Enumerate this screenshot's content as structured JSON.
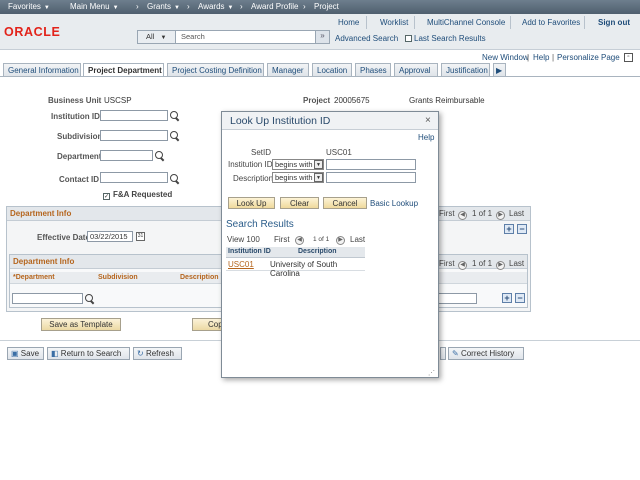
{
  "topnav": {
    "favorites": "Favorites",
    "main_menu": "Main Menu",
    "breadcrumb": [
      "Grants",
      "Awards",
      "Award Profile",
      "Project"
    ]
  },
  "header": {
    "links": [
      "Home",
      "Worklist",
      "MultiChannel Console",
      "Add to Favorites",
      "Sign out"
    ],
    "logo": "ORACLE",
    "search": {
      "scope": "All",
      "placeholder": "Search",
      "go": "»"
    },
    "advanced_search": "Advanced Search",
    "last_search_results": "Last Search Results"
  },
  "page_links": [
    "New Window",
    "Help",
    "Personalize Page"
  ],
  "tabs": [
    "General Information",
    "Project Department",
    "Project Costing Definition",
    "Manager",
    "Location",
    "Phases",
    "Approval",
    "Justification"
  ],
  "active_tab": "Project Department",
  "form": {
    "business_unit_label": "Business Unit",
    "business_unit_value": "USCSP",
    "project_label": "Project",
    "project_value": "20005675",
    "project_desc": "Grants Reimbursable",
    "institution_id_label": "Institution ID",
    "subdivision_label": "Subdivision",
    "department_label": "Department",
    "contact_id_label": "Contact ID",
    "fa_requested_label": "F&A Requested",
    "fa_requested_checked": true
  },
  "dept_group": {
    "title": "Department Info",
    "nav": {
      "first": "First",
      "count": "1 of 1",
      "last": "Last"
    },
    "effective_date_label": "Effective Date",
    "effective_date_value": "03/22/2015",
    "inner_title": "Department Info",
    "inner_nav": {
      "first": "First",
      "count": "1 of 1",
      "last": "Last"
    },
    "columns": [
      "*Department",
      "Subdivision",
      "Description"
    ]
  },
  "buttons": {
    "save_as_template": "Save as Template",
    "copy_partial": "Cop",
    "save": "Save",
    "return_to_search": "Return to Search",
    "refresh": "Refresh",
    "correct_history": "Correct History"
  },
  "lookup": {
    "title": "Look Up Institution ID",
    "close": "×",
    "help": "Help",
    "setid_label": "SetID",
    "setid_value": "USC01",
    "institution_id_label": "Institution ID",
    "institution_id_op": "begins with",
    "description_label": "Description",
    "description_op": "begins with",
    "btn_lookup": "Look Up",
    "btn_clear": "Clear",
    "btn_cancel": "Cancel",
    "basic_lookup": "Basic Lookup",
    "results_title": "Search Results",
    "view_100": "View 100",
    "first": "First",
    "count": "1 of 1",
    "last": "Last",
    "columns": [
      "Institution ID",
      "Description"
    ],
    "rows": [
      {
        "id": "USC01",
        "description": "University of South Carolina"
      }
    ]
  },
  "colors": {
    "nav_bg": "#5a6b7a",
    "oracle_red": "#e2231a",
    "group_title": "#b5651d",
    "link": "#1f4d7a",
    "button_fill": "#ecd9a4"
  }
}
